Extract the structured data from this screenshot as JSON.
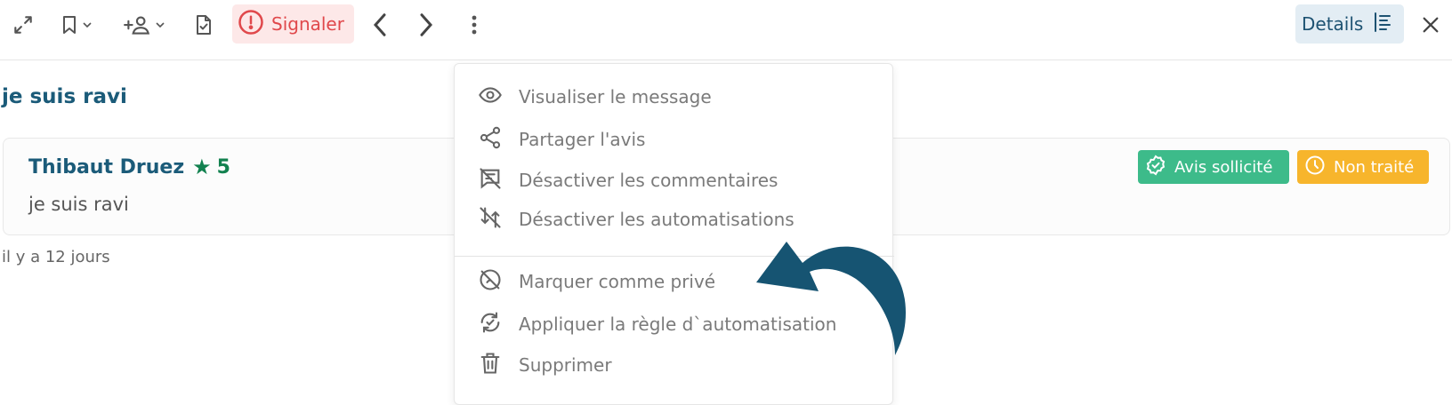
{
  "toolbar": {
    "signal_label": "Signaler",
    "details_label": "Details",
    "icons": [
      "expand-icon",
      "bookmark-icon",
      "add-user-icon",
      "document-check-icon",
      "alert-icon",
      "chevron-left-icon",
      "chevron-right-icon",
      "more-vertical-icon",
      "details-list-icon",
      "close-icon"
    ]
  },
  "review": {
    "heading": "je suis ravi",
    "author": "Thibaut Druez",
    "rating": "5",
    "text": "je suis ravi",
    "time": "il y a 12 jours",
    "badges": [
      "Avis sollicité",
      "Non traité"
    ]
  },
  "menu": {
    "items": [
      {
        "label": "Visualiser le message",
        "icon": "eye-icon"
      },
      {
        "label": "Partager l'avis",
        "icon": "share-icon"
      },
      {
        "label": "Désactiver les commentaires",
        "icon": "comment-off-icon"
      },
      {
        "label": "Désactiver les automatisations",
        "icon": "automation-off-icon"
      },
      {
        "label": "Marquer comme privé",
        "icon": "private-icon"
      },
      {
        "label": "Appliquer la règle d`automatisation",
        "icon": "apply-rule-icon"
      },
      {
        "label": "Supprimer",
        "icon": "trash-icon"
      }
    ]
  },
  "colors": {
    "accent": "#1b5b79",
    "signal": "#e0484b",
    "green_badge": "#3dbb8a",
    "orange_badge": "#f7b52c",
    "star": "#12814f",
    "arrow": "#165472"
  }
}
